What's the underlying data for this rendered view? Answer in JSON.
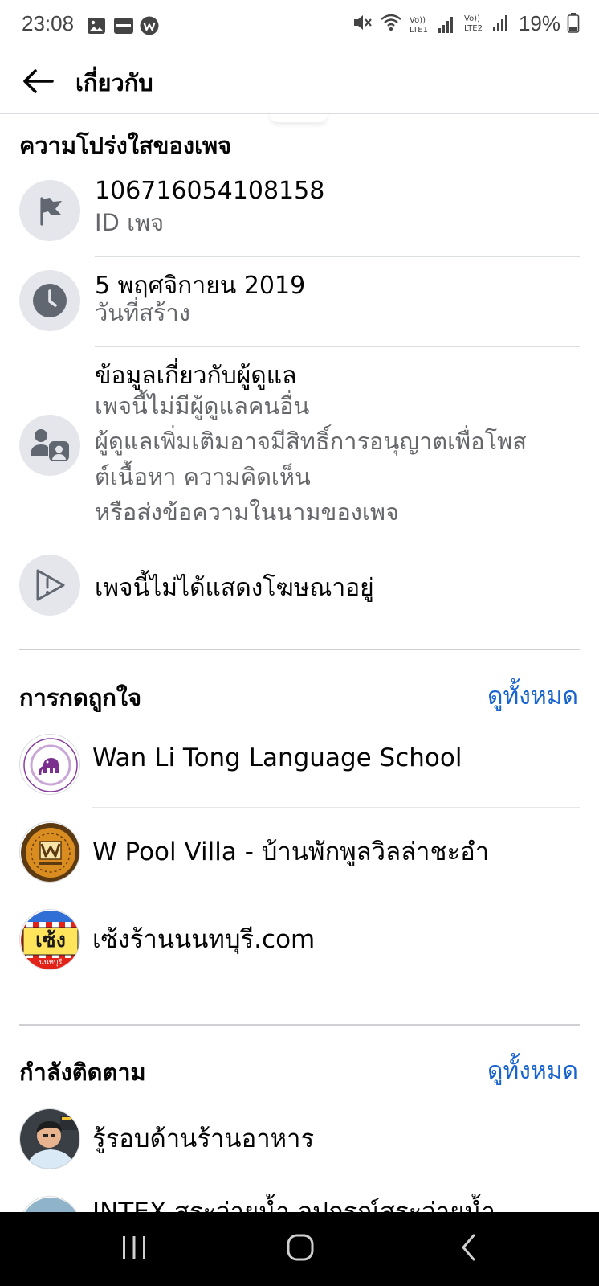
{
  "status_bar": {
    "time": "23:08",
    "icons": [
      "image-icon",
      "lazada-icon",
      "w-app-icon",
      "mute-icon",
      "wifi-icon",
      "signal-lte1-icon",
      "signal-lte2-icon",
      "battery-icon"
    ],
    "lte1": "Vo))\nLTE1",
    "lte2": "Vo))\nLTE2",
    "battery": "19%"
  },
  "header": {
    "title": "เกี่ยวกับ",
    "back_icon": "arrow-left-icon"
  },
  "transparency": {
    "title": "ความโปร่งใสของเพจ",
    "page_id": {
      "value": "106716054108158",
      "label": "ID เพจ",
      "icon": "flag-icon"
    },
    "created": {
      "value": "5 พฤศจิกายน  2019",
      "label": "วันที่สร้าง",
      "icon": "clock-icon"
    },
    "admin": {
      "title": "ข้อมูลเกี่ยวกับผู้ดูแล",
      "line1": "เพจนี้ไม่มีผู้ดูแลคนอื่น",
      "line2": "ผู้ดูแลเพิ่มเติมอาจมีสิทธิ์การอนุญาตเพื่อโพส",
      "line3": "ต์เนื้อหา ความคิดเห็น",
      "line4": "หรือส่งข้อความในนามของเพจ",
      "icon": "admin-icon"
    },
    "ads": {
      "value": "เพจนี้ไม่ได้แสดงโฆษณาอยู่",
      "icon": "ads-icon"
    }
  },
  "likes": {
    "title": "การกดถูกใจ",
    "see_all": "ดูทั้งหมด",
    "items": [
      {
        "name": "Wan Li Tong Language School"
      },
      {
        "name": "W Pool Villa - บ้านพักพูลวิลล่าชะอำ"
      },
      {
        "name": "เซ้งร้านนนทบุรี.com",
        "avatar_text": "เซ้ง",
        "avatar_sub": "นนทบุรี"
      }
    ]
  },
  "following": {
    "title": "กำลังติดตาม",
    "see_all": "ดูทั้งหมด",
    "items": [
      {
        "name": "รู้รอบด้านร้านอาหาร"
      },
      {
        "name": "INTEX สระว่ายน้ำ อุปกรณ์สระว่ายน้ำ"
      }
    ]
  },
  "nav": {
    "recents": "recents-icon",
    "home": "home-icon",
    "back": "back-icon"
  }
}
